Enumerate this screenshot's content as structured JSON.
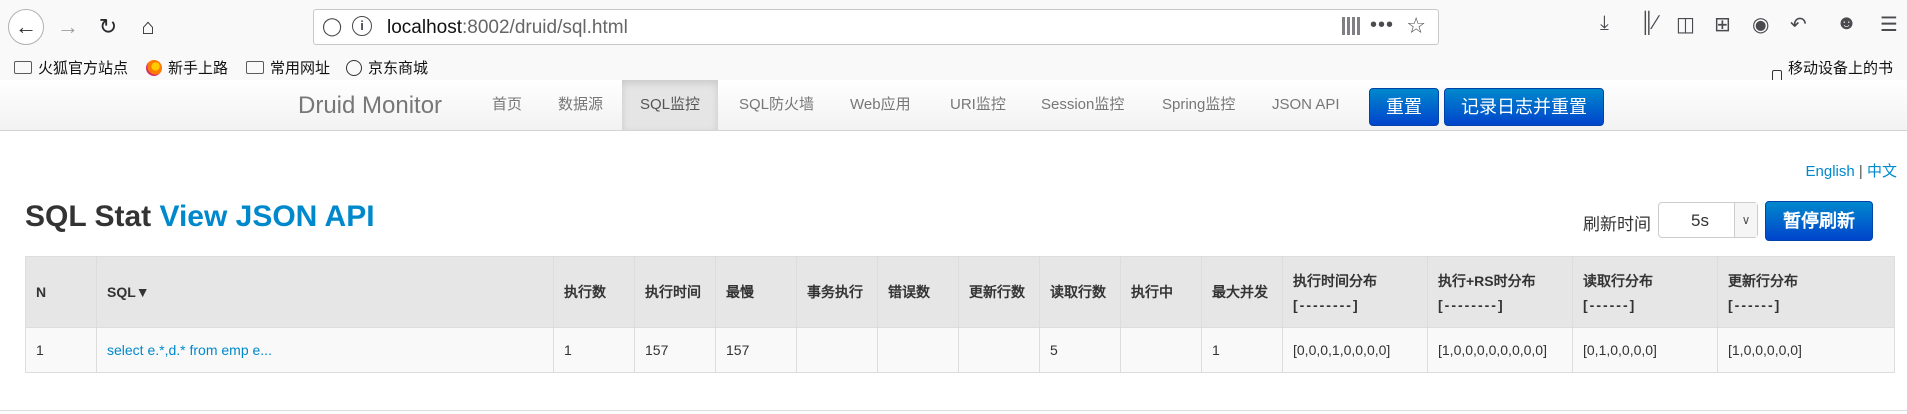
{
  "browser": {
    "url_host": "localhost",
    "url_rest": ":8002/druid/sql.html",
    "bookmarks": [
      "火狐官方站点",
      "新手上路",
      "常用网址",
      "京东商城"
    ],
    "mobile_bookmarks": "移动设备上的书签"
  },
  "navbar": {
    "brand": "Druid Monitor",
    "items": [
      "首页",
      "数据源",
      "SQL监控",
      "SQL防火墙",
      "Web应用",
      "URI监控",
      "Session监控",
      "Spring监控",
      "JSON API"
    ],
    "active_index": 2,
    "reset_button": "重置",
    "log_reset_button": "记录日志并重置"
  },
  "lang": {
    "english": "English",
    "separator": "|",
    "chinese": "中文"
  },
  "title": {
    "main": "SQL Stat",
    "link": "View JSON API"
  },
  "refresh": {
    "label": "刷新时间",
    "value": "5s",
    "pause_button": "暂停刷新"
  },
  "table": {
    "headers": [
      "N",
      "SQL▼",
      "执行数",
      "执行时间",
      "最慢",
      "事务执行",
      "错误数",
      "更新行数",
      "读取行数",
      "执行中",
      "最大并发",
      "执行时间分布",
      "执行+RS时分布",
      "读取行分布",
      "更新行分布"
    ],
    "header_subs": {
      "11": "[--------]",
      "12": "[--------]",
      "13": "[------]",
      "14": "[------]"
    },
    "rows": [
      [
        "1",
        "select e.*,d.* from emp e...",
        "1",
        "157",
        "157",
        "",
        "",
        "",
        "5",
        "",
        "1",
        "[0,0,0,1,0,0,0,0]",
        "[1,0,0,0,0,0,0,0,0]",
        "[0,1,0,0,0,0]",
        "[1,0,0,0,0,0]"
      ]
    ]
  }
}
